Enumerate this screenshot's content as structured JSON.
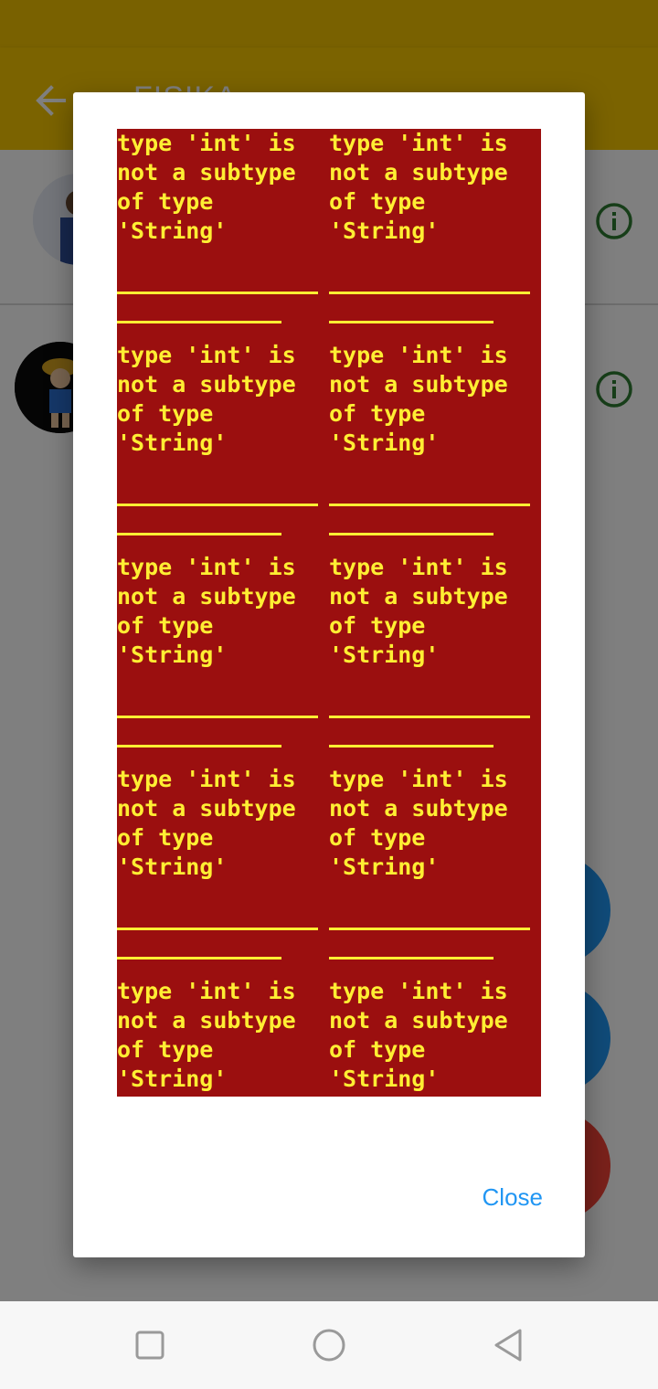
{
  "app": {
    "title": "FISIKA"
  },
  "dialog": {
    "error_messages": [
      "type 'int' is not a subtype of type 'String'",
      "type 'int' is not a subtype of type 'String'",
      "type 'int' is not a subtype of type 'String'",
      "type 'int' is not a subtype of type 'String'",
      "type 'int' is not a subtype of type 'String'",
      "type 'int' is not a subtype of type 'String'",
      "type 'int' is not a subtype of type 'String'",
      "type 'int' is not a subtype of type 'String'",
      "type 'int' is not a subtype of type 'String'",
      "type 'int' is not a subtype of type 'String'"
    ],
    "close_label": "Close"
  },
  "colors": {
    "appbar": "#f7c600",
    "error_background": "#9b0f0f",
    "error_text": "#ffee33",
    "accent": "#2196f3",
    "fab_red": "#f44336",
    "info_icon": "#2e7d32"
  },
  "icons": {
    "back": "arrow-left-icon",
    "info": "info-circle-icon",
    "nav_recent": "square-icon",
    "nav_home": "circle-icon",
    "nav_back": "triangle-back-icon"
  }
}
